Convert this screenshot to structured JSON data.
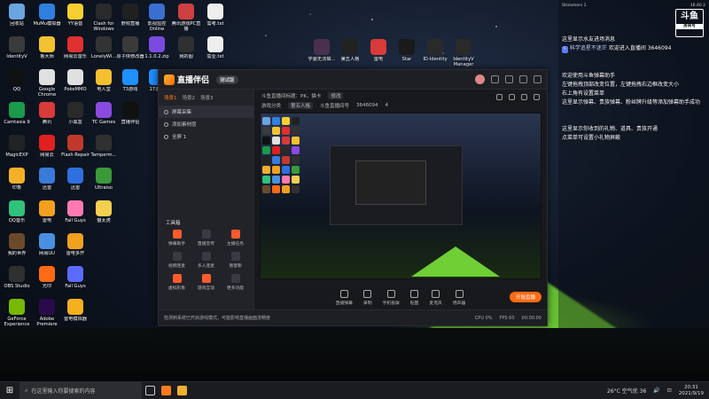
{
  "desktop": {
    "icons_col1": [
      {
        "label": "回收站",
        "color": "#6aa5e0"
      },
      {
        "label": "IdentityV",
        "color": "#3b3b3b"
      },
      {
        "label": "QQ",
        "color": "#111111"
      },
      {
        "label": "Camtasia 9",
        "color": "#1a9a4a"
      },
      {
        "label": "MagicEXP",
        "color": "#222222"
      },
      {
        "label": "印象",
        "color": "#f5b02a"
      },
      {
        "label": "QQ音乐",
        "color": "#31c27c"
      },
      {
        "label": "我的世界",
        "color": "#6b4a2a"
      },
      {
        "label": "OBS Studio",
        "color": "#303030"
      },
      {
        "label": "GeForce Experience",
        "color": "#76b900"
      }
    ],
    "icons_col2": [
      {
        "label": "MuMu模拟器",
        "color": "#2e7fe0"
      },
      {
        "label": "鲁大师",
        "color": "#f2c230"
      },
      {
        "label": "Google Chrome",
        "color": "#e0e0e0"
      },
      {
        "label": "腾讯",
        "color": "#d93a3a"
      },
      {
        "label": "网易云",
        "color": "#e02020"
      },
      {
        "label": "迅雷",
        "color": "#3a7ad9"
      },
      {
        "label": "雷电",
        "color": "#f2a020"
      },
      {
        "label": "网易UU",
        "color": "#4a90e0"
      },
      {
        "label": "光印",
        "color": "#ff6a13"
      },
      {
        "label": "Adobe Premiere",
        "color": "#2a0a4a"
      }
    ],
    "icons_col3": [
      {
        "label": "YY语音",
        "color": "#f7d030"
      },
      {
        "label": "网易云音乐",
        "color": "#e03030"
      },
      {
        "label": "PokeMMO",
        "color": "#e0e0e0"
      },
      {
        "label": "小黑盒",
        "color": "#2a2a2a"
      },
      {
        "label": "Flash Repair",
        "color": "#c0392b"
      },
      {
        "label": "迅雷",
        "color": "#2f6fe0"
      },
      {
        "label": "Fall Guys",
        "color": "#ff7ab0"
      },
      {
        "label": "雷电多开",
        "color": "#f2a020"
      },
      {
        "label": "Fall Guys",
        "color": "#5b6bff"
      },
      {
        "label": "雷电模拟器",
        "color": "#f5b020"
      }
    ],
    "icons_col4": [
      {
        "label": "Clash for Windows",
        "color": "#2a2a2a"
      },
      {
        "label": "LonelyWi...",
        "color": "#333333"
      },
      {
        "label": "电人堂",
        "color": "#f5c030"
      },
      {
        "label": "TC Games",
        "color": "#8a4ae0"
      },
      {
        "label": "Tamperm...",
        "color": "#303030"
      },
      {
        "label": "Ultraiso",
        "color": "#3a9a3a"
      },
      {
        "label": "猫太虎",
        "color": "#f5d050"
      }
    ],
    "icons_col5": [
      {
        "label": "野狗直播",
        "color": "#202020"
      },
      {
        "label": "原子侠修改器",
        "color": "#3a3a3a"
      },
      {
        "label": "T3游戏",
        "color": "#1e90ff"
      },
      {
        "label": "直播伴侣",
        "color": "#111111"
      }
    ],
    "icons_col6": [
      {
        "label": "影视监控 Online",
        "color": "#3a6fd0"
      },
      {
        "label": "1.1.0.2.zip",
        "color": "#7a4ae0"
      },
      {
        "label": "17游戏",
        "color": "#1e90ff"
      }
    ],
    "icons_col7": [
      {
        "label": "腾讯游戏PC直播",
        "color": "#d04040"
      },
      {
        "label": "我的图",
        "color": "#303030"
      }
    ],
    "icons_col8": [
      {
        "label": "需考.txt",
        "color": "#eeeeee"
      },
      {
        "label": "需业.txt",
        "color": "#eeeeee"
      }
    ],
    "icons_mid": [
      {
        "label": "学委无法搞...",
        "color": "#4a3050"
      },
      {
        "label": "第五人格",
        "color": "#222222"
      },
      {
        "label": "雷电",
        "color": "#d93a3a"
      },
      {
        "label": "Star",
        "color": "#1a1a1a"
      },
      {
        "label": "ID-Identity",
        "color": "#2a2a2a"
      },
      {
        "label": "IdentityV Manager",
        "color": "#2a2a2a"
      }
    ]
  },
  "app": {
    "brand": "直播伴侣",
    "version": "测试版",
    "scene_tabs": [
      "场景1",
      "场景2",
      "场景3"
    ],
    "sources": [
      {
        "label": "屏幕采集"
      },
      {
        "label": "添加素材层"
      },
      {
        "label": "全屏 1"
      }
    ],
    "tools_title": "工具箱",
    "tools": [
      {
        "label": "弹幕助手",
        "hot": true
      },
      {
        "label": "直播宣传",
        "hot": false
      },
      {
        "label": "主播任务",
        "hot": true
      },
      {
        "label": "视频连麦",
        "hot": false
      },
      {
        "label": "多人连麦",
        "hot": false
      },
      {
        "label": "语音聊",
        "hot": false
      },
      {
        "label": "虚拟形象",
        "hot": true
      },
      {
        "label": "游戏互动",
        "hot": true
      },
      {
        "label": "更多功能",
        "hot": false
      }
    ],
    "stream_info": {
      "title_label": "斗鱼直播间标题：PK，猫卡",
      "edit_label": "修改",
      "category_label": "游戏分类",
      "category_value": "第五人格",
      "room_label": "斗鱼直播间号",
      "room_value": "3646094",
      "viewers": "4"
    },
    "controls": [
      {
        "label": "直播弹幕"
      },
      {
        "label": "录制"
      },
      {
        "label": "手机投屏"
      },
      {
        "label": "贴图"
      },
      {
        "label": "麦克风"
      },
      {
        "label": "扬声器"
      }
    ],
    "live_button": "开始直播",
    "status": {
      "notice": "检测到系统已开启游戏模式，可能影响直播画面流畅度",
      "cpu": "CPU 0%",
      "fps": "FPS 60",
      "time": "00:00:00"
    }
  },
  "chat": {
    "top_left": "Streamers 1",
    "top_right": "16:40 2",
    "room_badge": {
      "main": "斗鱼",
      "sub": "房间号"
    },
    "room_number": "3646094",
    "messages": [
      {
        "text": "这里显示水友进场消息"
      },
      {
        "level": "6",
        "name": "科学追星不迷茫",
        "text": "欢迎进入直播间 3646094"
      },
      {
        "text": "欢迎使用斗鱼弹幕助手"
      },
      {
        "text": "左键拖拽顶部改变位置，左键拖拽右边框改变大小"
      },
      {
        "text": "右上角有设置菜单"
      },
      {
        "text": "这里显示弹幕、贵族弹幕、粉丝牌升级等添加弹幕助手成功"
      },
      {
        "text": "这里显示你收到的礼物、道具、贵族开通"
      },
      {
        "text": "点菜单可设置小礼物屏蔽"
      }
    ]
  },
  "taskbar": {
    "search_placeholder": "在这里输入你要搜索的内容",
    "weather": "26°C 空气优 36",
    "time": "20:31",
    "date": "2021/9/19"
  }
}
